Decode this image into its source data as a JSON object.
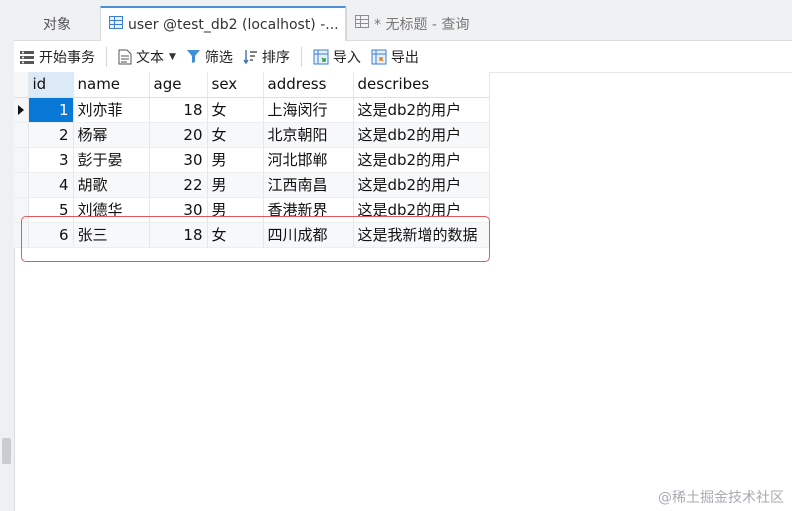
{
  "tabs": [
    {
      "label": "对象"
    },
    {
      "label": "user @test_db2 (localhost) -..."
    },
    {
      "label": "* 无标题 - 查询"
    }
  ],
  "toolbar": {
    "begin_transaction": "开始事务",
    "text": "文本",
    "filter": "筛选",
    "sort": "排序",
    "import": "导入",
    "export": "导出"
  },
  "table": {
    "columns": [
      "id",
      "name",
      "age",
      "sex",
      "address",
      "describes"
    ],
    "rows": [
      [
        "1",
        "刘亦菲",
        "18",
        "女",
        "上海闵行",
        "这是db2的用户"
      ],
      [
        "2",
        "杨幂",
        "20",
        "女",
        "北京朝阳",
        "这是db2的用户"
      ],
      [
        "3",
        "彭于晏",
        "30",
        "男",
        "河北邯郸",
        "这是db2的用户"
      ],
      [
        "4",
        "胡歌",
        "22",
        "男",
        "江西南昌",
        "这是db2的用户"
      ],
      [
        "5",
        "刘德华",
        "30",
        "男",
        "香港新界",
        "这是db2的用户"
      ],
      [
        "6",
        "张三",
        "18",
        "女",
        "四川成都",
        "这是我新增的数据"
      ]
    ]
  },
  "watermark": "@稀土掘金技术社区",
  "colors": {
    "accent": "#0a78d7",
    "highlight": "#e4575b"
  }
}
